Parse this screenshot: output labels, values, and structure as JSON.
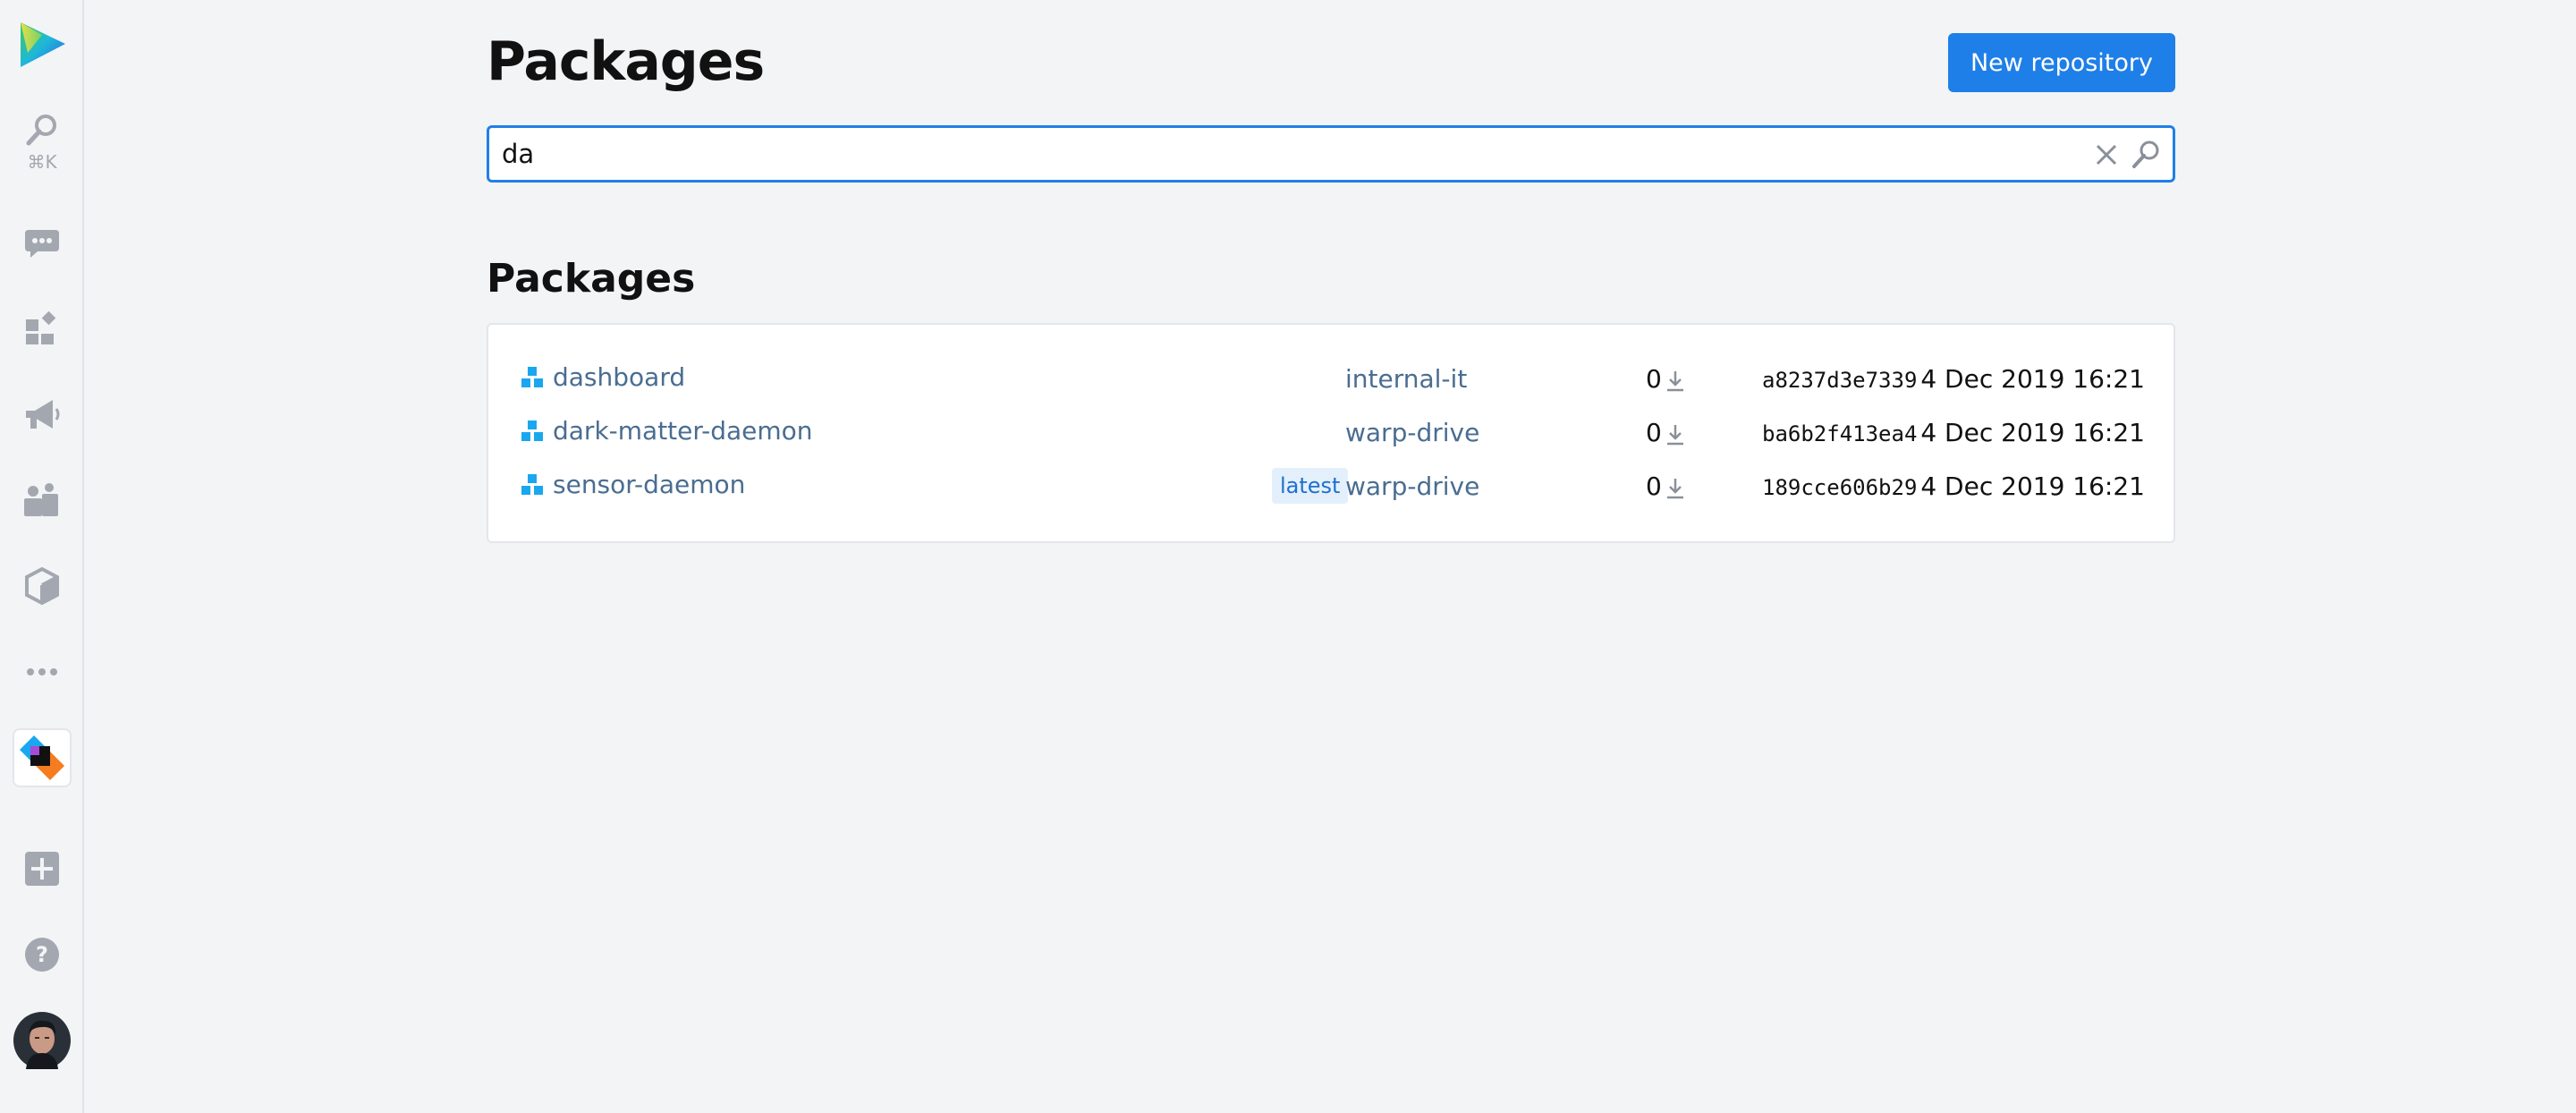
{
  "sidebar": {
    "search_hint": "⌘K"
  },
  "header": {
    "title": "Packages",
    "new_repo_label": "New repository"
  },
  "search": {
    "value": "da",
    "placeholder": ""
  },
  "section": {
    "title": "Packages"
  },
  "packages": [
    {
      "name": "dashboard",
      "badge": "",
      "repo": "internal-it",
      "downloads": "0",
      "hash": "a8237d3e7339",
      "date": "4 Dec 2019 16:21"
    },
    {
      "name": "dark-matter-daemon",
      "badge": "",
      "repo": "warp-drive",
      "downloads": "0",
      "hash": "ba6b2f413ea4",
      "date": "4 Dec 2019 16:21"
    },
    {
      "name": "sensor-daemon",
      "badge": "latest",
      "repo": "warp-drive",
      "downloads": "0",
      "hash": "189cce606b29",
      "date": "4 Dec 2019 16:21"
    }
  ],
  "colors": {
    "accent": "#1f7fe8",
    "link": "#4a6d91",
    "badge_bg": "#e3f0fc"
  }
}
